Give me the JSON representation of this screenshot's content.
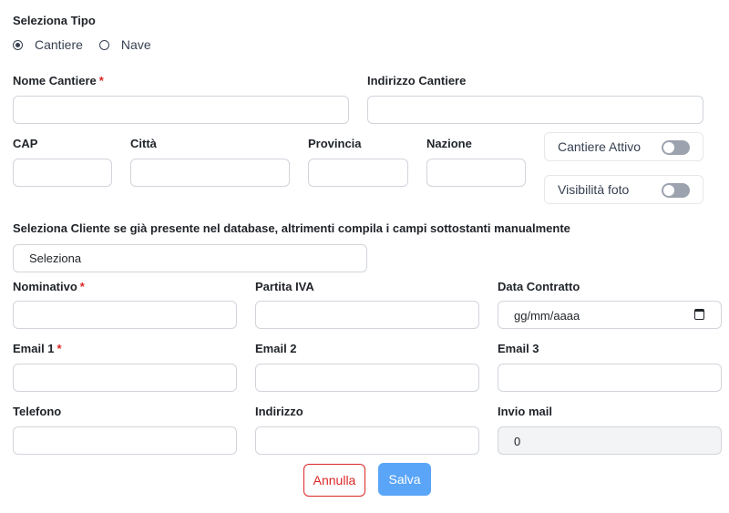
{
  "tipo": {
    "title": "Seleziona Tipo",
    "options": [
      "Cantiere",
      "Nave"
    ],
    "selected": "Cantiere"
  },
  "cantiere": {
    "nome_label": "Nome Cantiere",
    "indirizzo_label": "Indirizzo Cantiere",
    "cap_label": "CAP",
    "citta_label": "Città",
    "provincia_label": "Provincia",
    "nazione_label": "Nazione",
    "attivo_label": "Cantiere Attivo",
    "visibilita_label": "Visibilità foto"
  },
  "cliente": {
    "select_hint": "Seleziona Cliente se già presente nel database, altrimenti compila i campi sottostanti manualmente",
    "select_value": "Seleziona",
    "nominativo_label": "Nominativo",
    "partita_iva_label": "Partita IVA",
    "data_contratto_label": "Data Contratto",
    "data_contratto_placeholder": "gg/mm/aaaa",
    "email1_label": "Email 1",
    "email2_label": "Email 2",
    "email3_label": "Email 3",
    "telefono_label": "Telefono",
    "indirizzo_label": "Indirizzo",
    "invio_mail_label": "Invio mail",
    "invio_mail_value": "0"
  },
  "required_mark": "*",
  "actions": {
    "cancel": "Annulla",
    "save": "Salva"
  }
}
